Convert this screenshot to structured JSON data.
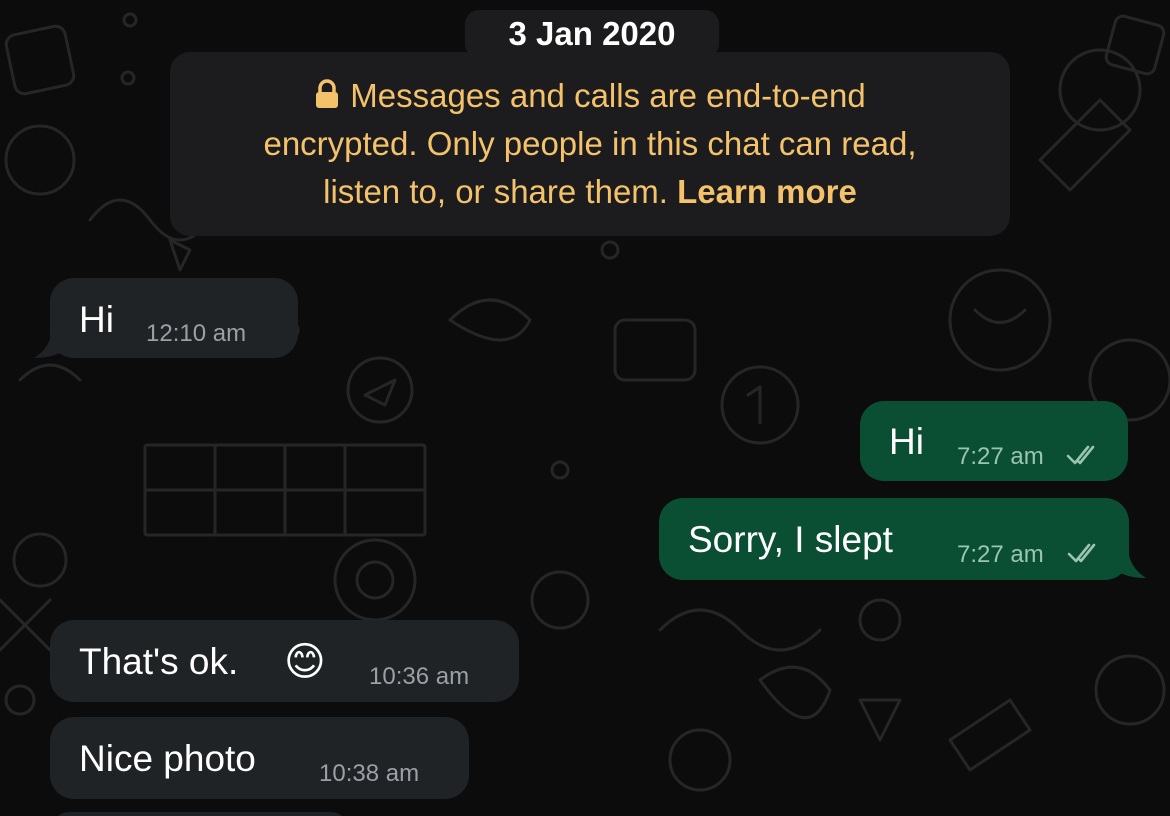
{
  "date_separator": "3 Jan 2020",
  "encryption_notice": {
    "line1": "Messages and calls are end-to-end",
    "line2": "encrypted. Only people in this chat can read,",
    "line3_prefix": "listen to, or share them.",
    "learn_more": "Learn more",
    "icon": "lock-icon"
  },
  "messages": [
    {
      "direction": "incoming",
      "text": "Hi",
      "time": "12:10 am"
    },
    {
      "direction": "outgoing",
      "text": "Hi",
      "time": "7:27 am",
      "status": "read"
    },
    {
      "direction": "outgoing",
      "text": "Sorry, I slept",
      "time": "7:27 am",
      "status": "read"
    },
    {
      "direction": "incoming",
      "text": "That's ok.",
      "emoji": "😊",
      "time": "10:36 am"
    },
    {
      "direction": "incoming",
      "text": "Nice photo",
      "time": "10:38 am"
    }
  ],
  "colors": {
    "background": "#0c0c0c",
    "incoming_bubble": "#1f2326",
    "outgoing_bubble": "#0a4f34",
    "notice_text": "#f3c26a",
    "read_ticks": "#9ac5b0"
  }
}
